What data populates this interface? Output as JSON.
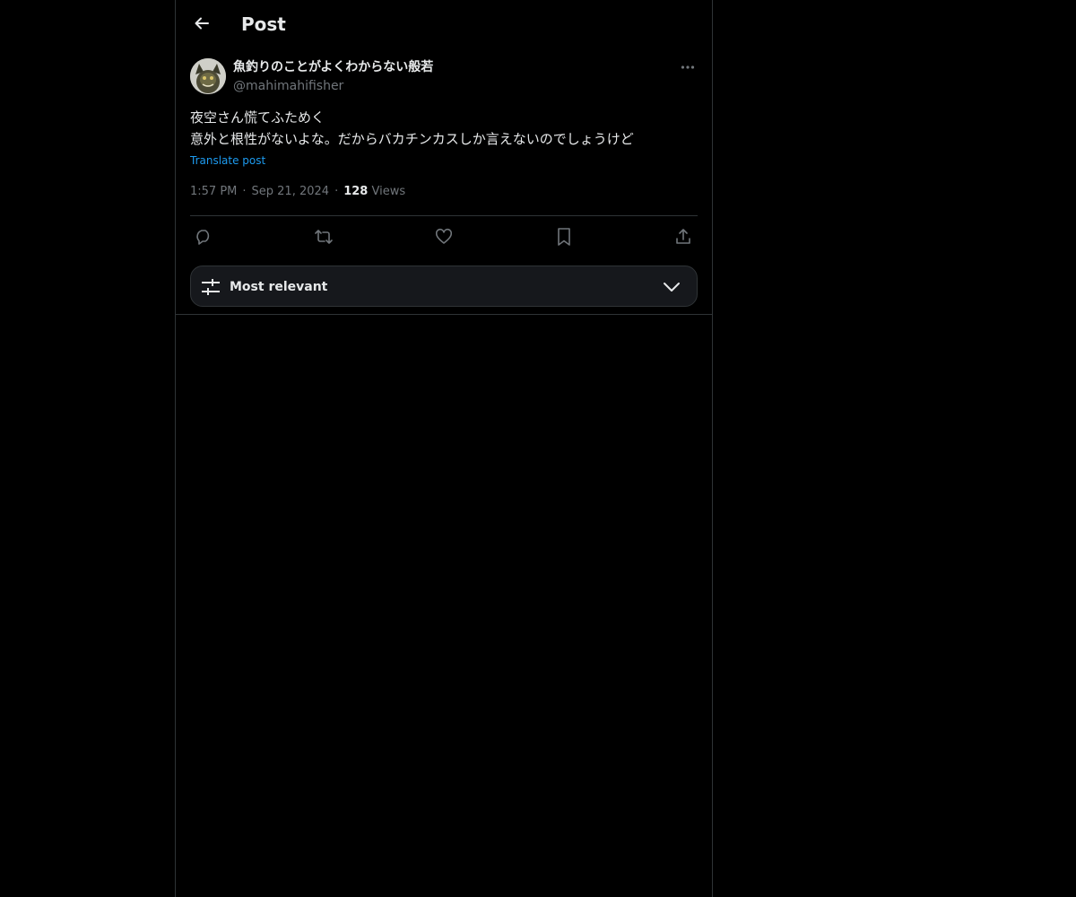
{
  "header": {
    "title": "Post"
  },
  "author": {
    "display_name": "魚釣りのことがよくわからない般若",
    "handle": "@mahimahifisher"
  },
  "post": {
    "lines": [
      "夜空さん慌てふためく",
      "意外と根性がないよな。だからバカチンカスしか言えないのでしょうけど"
    ],
    "translate_label": "Translate post",
    "time": "1:57 PM",
    "date": "Sep 21, 2024",
    "views_count": "128",
    "views_label": "Views",
    "separator": "·"
  },
  "actions": {
    "reply": "reply-icon",
    "repost": "repost-icon",
    "like": "heart-icon",
    "bookmark": "bookmark-icon",
    "share": "share-icon"
  },
  "sort": {
    "label": "Most relevant"
  },
  "colors": {
    "background": "#000000",
    "text": "#e7e9ea",
    "muted": "#71767b",
    "link": "#1d9bf0",
    "border": "#2f3336",
    "sort_bg": "#16181c"
  }
}
